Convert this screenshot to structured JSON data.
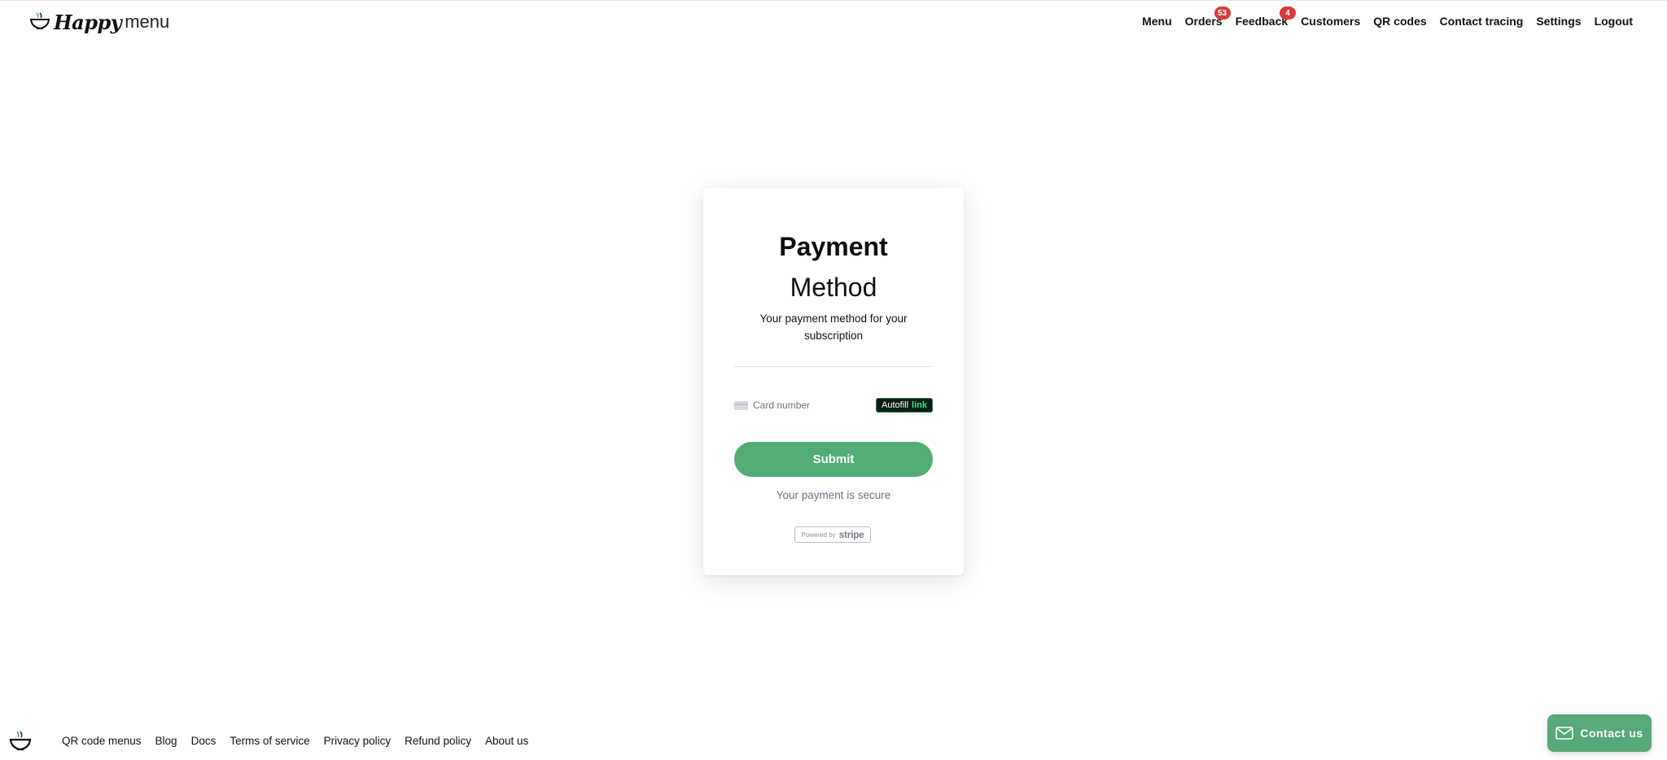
{
  "header": {
    "logo": {
      "brand_bold": "Happy",
      "brand_light": "menu"
    },
    "nav": [
      {
        "label": "Menu",
        "badge": null
      },
      {
        "label": "Orders",
        "badge": "53"
      },
      {
        "label": "Feedback",
        "badge": "4"
      },
      {
        "label": "Customers",
        "badge": null
      },
      {
        "label": "QR codes",
        "badge": null
      },
      {
        "label": "Contact tracing",
        "badge": null
      },
      {
        "label": "Settings",
        "badge": null
      },
      {
        "label": "Logout",
        "badge": null
      }
    ]
  },
  "payment": {
    "title_bold": "Payment",
    "title_light": "Method",
    "subtitle": "Your payment method for your subscription",
    "card_placeholder": "Card number",
    "autofill_label": "Autofill",
    "autofill_link": "link",
    "submit_label": "Submit",
    "secure_text": "Your payment is secure",
    "powered_by": "Powered by",
    "stripe": "stripe"
  },
  "footer": {
    "links": [
      "QR code menus",
      "Blog",
      "Docs",
      "Terms of service",
      "Privacy policy",
      "Refund policy",
      "About us"
    ]
  },
  "contact_button": {
    "label": "Contact us"
  },
  "colors": {
    "accent_green": "#52ac76",
    "badge_red": "#d83b3b",
    "link_green": "#3ddc84"
  },
  "icons": [
    "bowl-logo-icon",
    "credit-card-icon",
    "envelope-icon"
  ]
}
